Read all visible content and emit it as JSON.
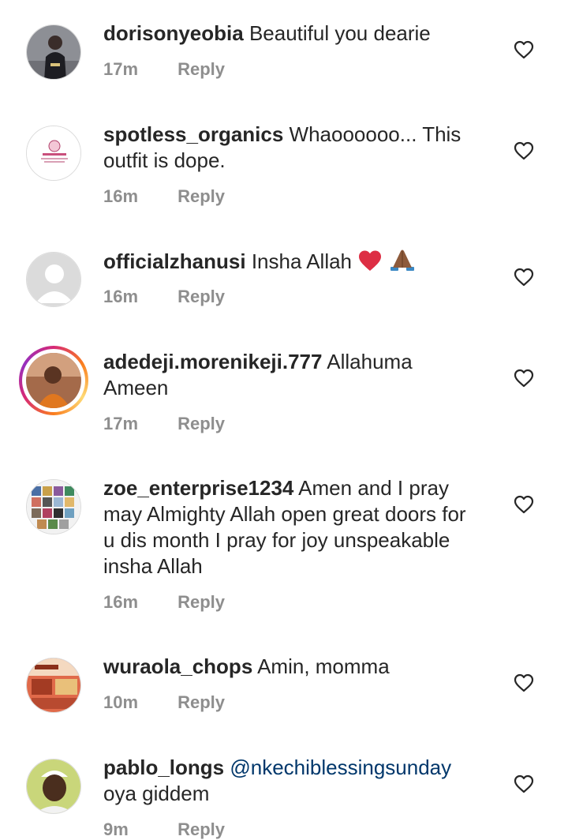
{
  "comments": [
    {
      "username": "dorisonyeobia",
      "text": "Beautiful you dearie",
      "time": "17m",
      "reply": "Reply"
    },
    {
      "username": "spotless_organics",
      "text": "Whaoooooo... This outfit is dope.",
      "time": "16m",
      "reply": "Reply"
    },
    {
      "username": "officialzhanusi",
      "text": "Insha Allah",
      "time": "16m",
      "reply": "Reply",
      "emojis": [
        "red-heart",
        "folded-hands"
      ]
    },
    {
      "username": "adedeji.morenikeji.777",
      "text": "Allahuma Ameen",
      "time": "17m",
      "reply": "Reply"
    },
    {
      "username": "zoe_enterprise1234",
      "text": "Amen and I pray may Almighty Allah open great doors for u dis month I pray for joy unspeakable insha Allah",
      "time": "16m",
      "reply": "Reply"
    },
    {
      "username": "wuraola_chops",
      "text": "Amin, momma",
      "time": "10m",
      "reply": "Reply"
    },
    {
      "username": "pablo_longs",
      "mention": "@nkechiblessingsunday",
      "text": "oya giddem",
      "time": "9m",
      "reply": "Reply"
    }
  ],
  "colors": {
    "text": "#262626",
    "meta": "#8e8e8e",
    "mention": "#00376b"
  }
}
